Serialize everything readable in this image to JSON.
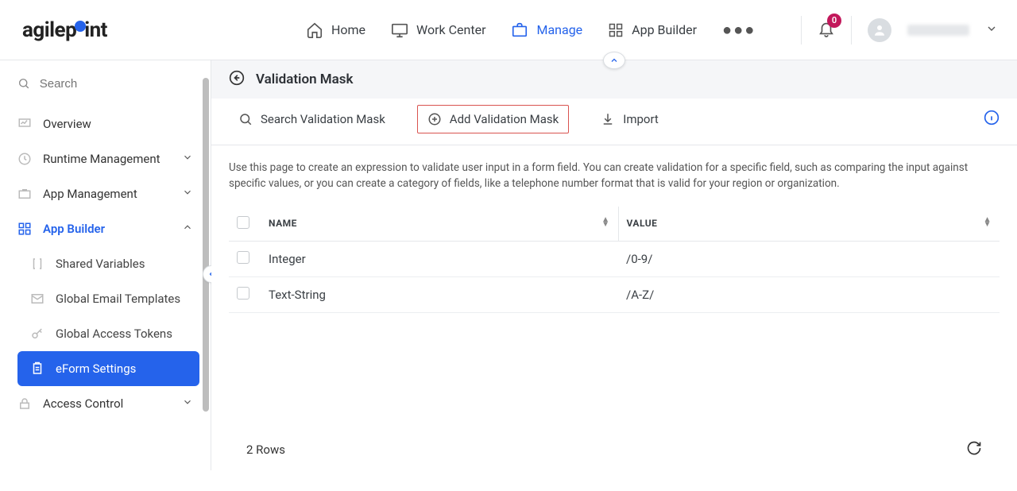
{
  "header": {
    "logo": "agilepoint",
    "nav": {
      "home": "Home",
      "work_center": "Work Center",
      "manage": "Manage",
      "app_builder": "App Builder"
    },
    "notifications": "0"
  },
  "sidebar": {
    "search_placeholder": "Search",
    "overview": "Overview",
    "runtime_mgmt": "Runtime Management",
    "app_mgmt": "App Management",
    "app_builder": "App Builder",
    "shared_vars": "Shared Variables",
    "email_tmpl": "Global Email Templates",
    "access_tokens": "Global Access Tokens",
    "eform_settings": "eForm Settings",
    "access_control": "Access Control"
  },
  "page": {
    "title": "Validation Mask",
    "search_placeholder": "Search Validation Mask",
    "add_label": "Add Validation Mask",
    "import_label": "Import",
    "description": "Use this page to create an expression to validate user input in a form field. You can create validation for a specific field, such as comparing the input against specific values, or you can create a category of fields, like a telephone number format that is valid for your region or organization.",
    "col_name": "NAME",
    "col_value": "VALUE",
    "rows": [
      {
        "name": "Integer",
        "value": "/0-9/"
      },
      {
        "name": "Text-String",
        "value": "/A-Z/"
      }
    ],
    "row_count": "2 Rows"
  }
}
